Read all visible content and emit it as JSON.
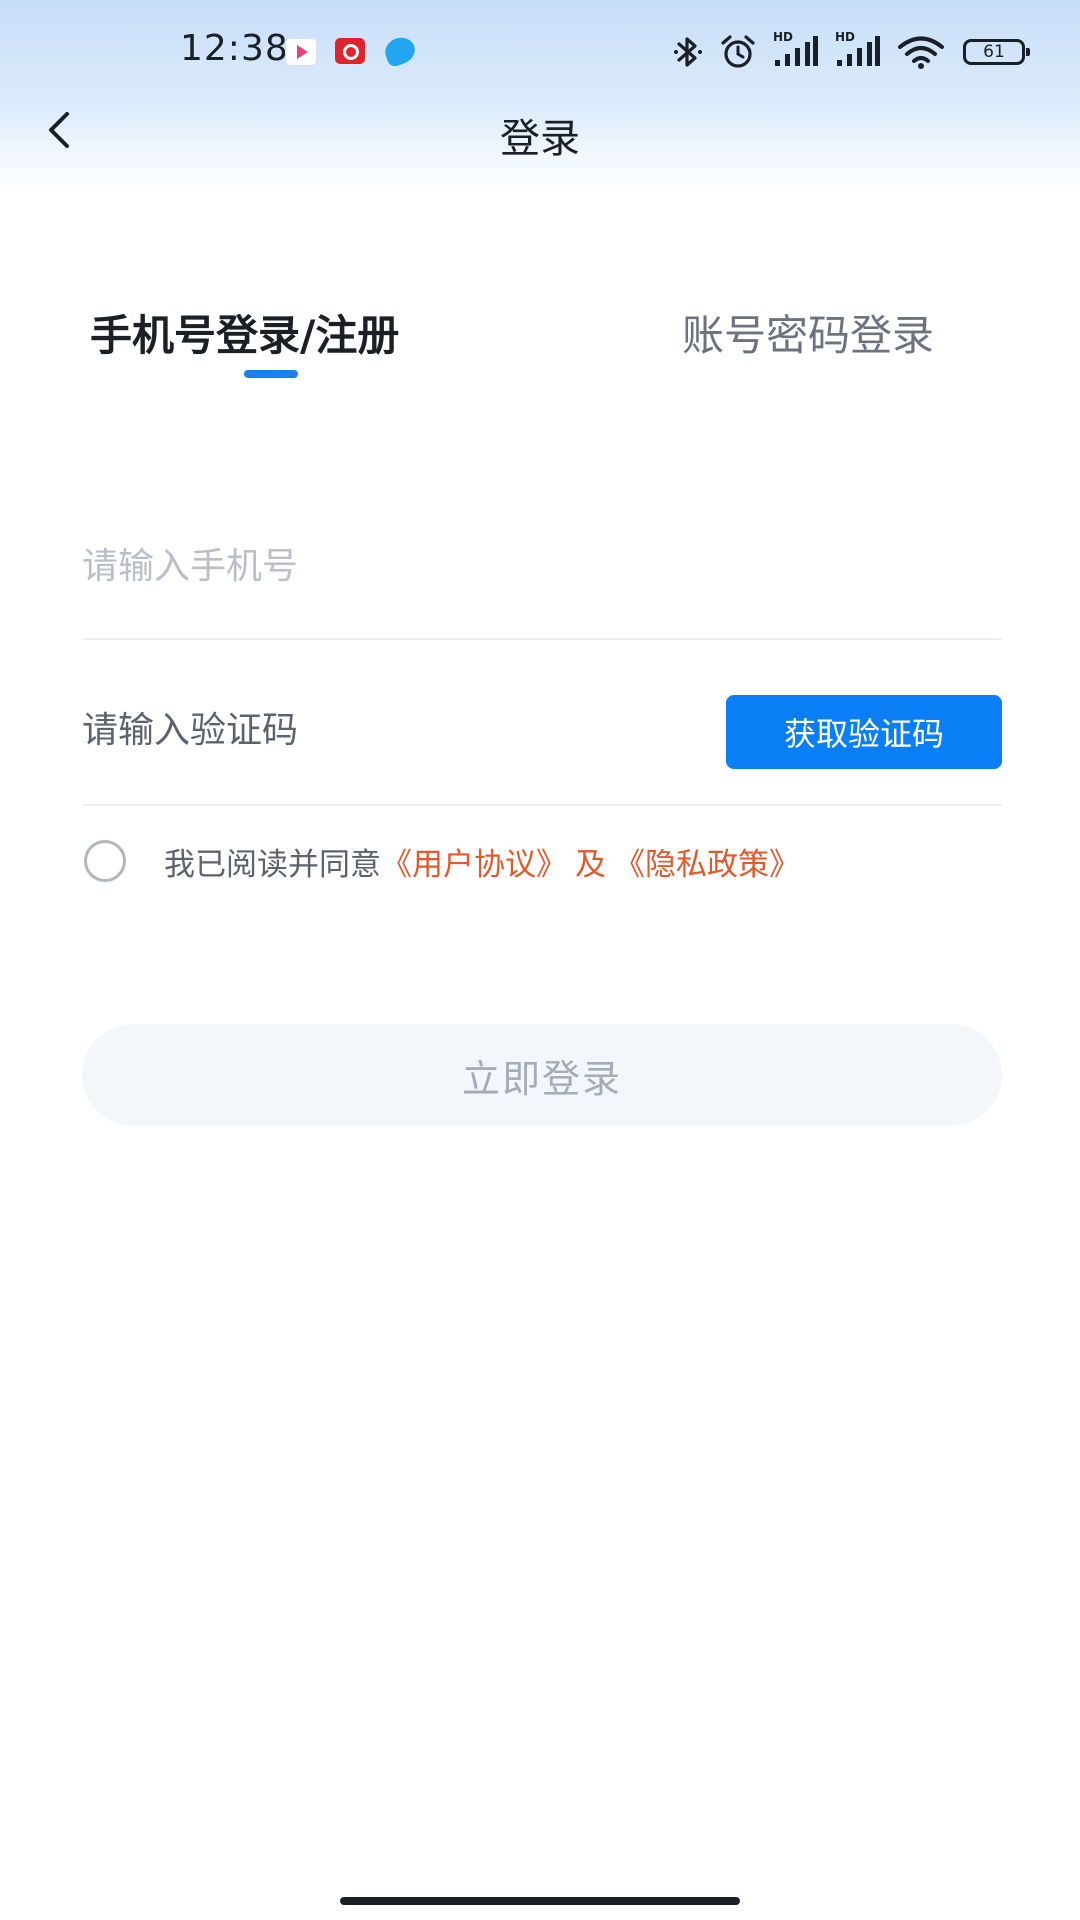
{
  "status_bar": {
    "time": "12:38",
    "battery": "61",
    "hd_label": "HD",
    "notifications": [
      "video-app-icon",
      "music-app-icon",
      "bird-app-icon"
    ]
  },
  "nav": {
    "title": "登录"
  },
  "tabs": [
    {
      "label": "手机号登录/注册",
      "active": true
    },
    {
      "label": "账号密码登录",
      "active": false
    }
  ],
  "form": {
    "phone_placeholder": "请输入手机号",
    "code_placeholder": "请输入验证码",
    "get_code_label": "获取验证码"
  },
  "agreement": {
    "text": "我已阅读并同意",
    "user_agreement": "《用户协议》",
    "separator": "及",
    "privacy_policy": "《隐私政策》"
  },
  "login_button": {
    "label": "立即登录"
  },
  "colors": {
    "accent": "#0a7ef4",
    "link": "#e15a2e",
    "button_disabled_bg": "#f3f6fa"
  }
}
